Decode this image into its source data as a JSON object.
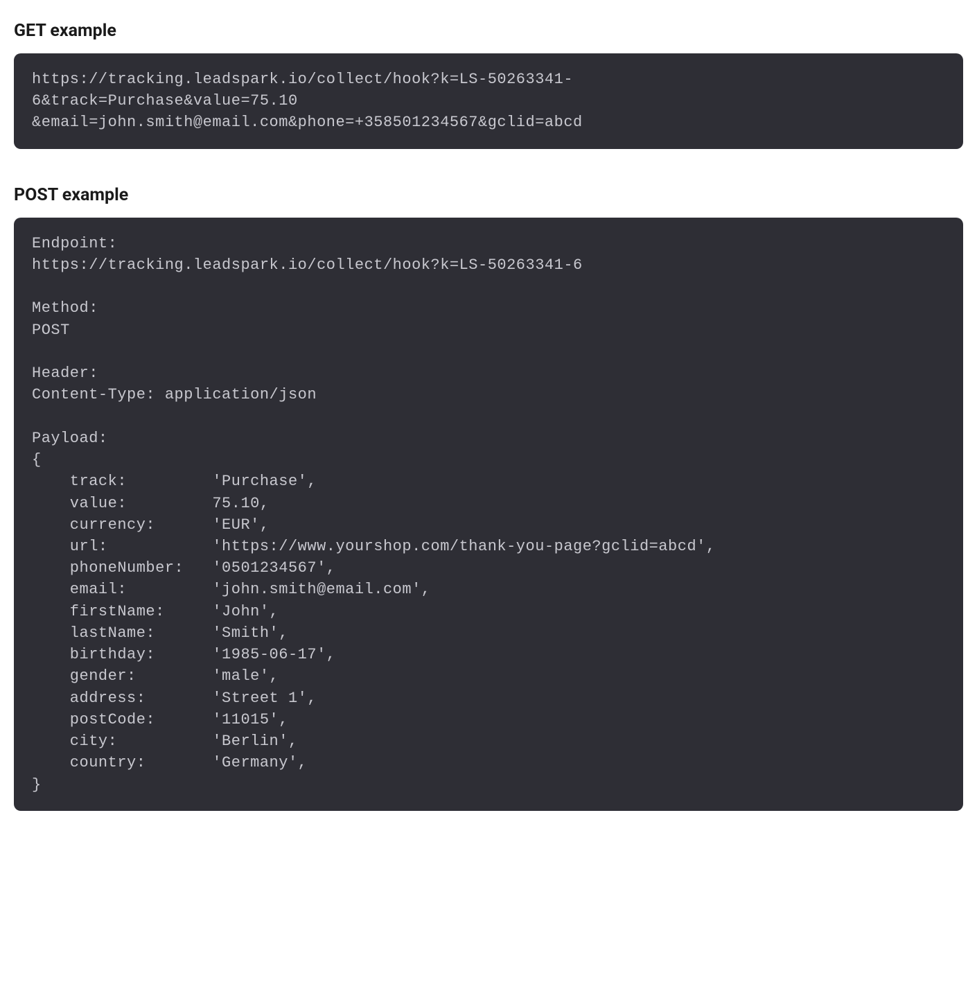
{
  "get_section": {
    "heading": "GET example",
    "code": "https://tracking.leadspark.io/collect/hook?k=LS-50263341-\n6&track=Purchase&value=75.10\n&email=john.smith@email.com&phone=+358501234567&gclid=abcd"
  },
  "post_section": {
    "heading": "POST example",
    "code": "Endpoint:\nhttps://tracking.leadspark.io/collect/hook?k=LS-50263341-6\n\nMethod:\nPOST\n\nHeader:\nContent-Type: application/json\n\nPayload:\n{\n    track:         'Purchase',\n    value:         75.10,\n    currency:      'EUR',\n    url:           'https://www.yourshop.com/thank-you-page?gclid=abcd',\n    phoneNumber:   '0501234567',\n    email:         'john.smith@email.com',\n    firstName:     'John',\n    lastName:      'Smith',\n    birthday:      '1985-06-17',\n    gender:        'male',\n    address:       'Street 1',\n    postCode:      '11015',\n    city:          'Berlin',\n    country:       'Germany',\n}"
  }
}
